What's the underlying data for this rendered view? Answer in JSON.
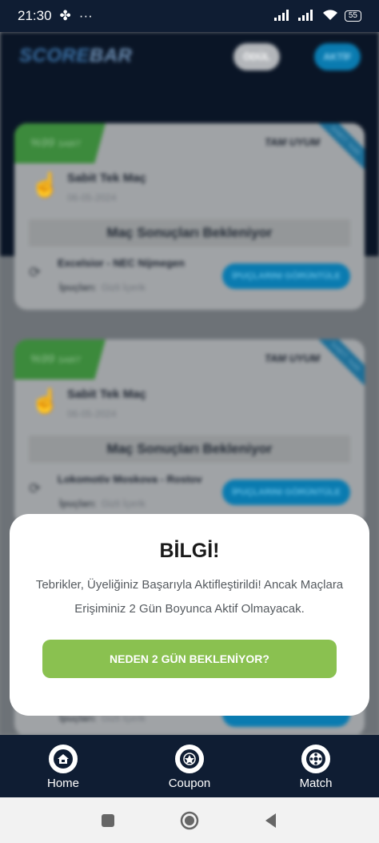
{
  "status_bar": {
    "time": "21:30",
    "dots": "···",
    "battery": "55"
  },
  "app": {
    "logo_main": "SCORE",
    "logo_accent": "BAR",
    "pill_odul": "ÖDÜL",
    "pill_aktif": "AKTİF",
    "cards": [
      {
        "ribbon_value": "%99",
        "ribbon_suffix": "SABİT",
        "tam_uyum": "TAM UYUM",
        "corner": "SABİT: %99",
        "title": "Sabit Tek Maç",
        "date": "06-05-2024",
        "waiting": "Maç Sonuçları Bekleniyor",
        "match": "Excelsior - NEC Nijmegen",
        "hint_label": "İpuçları:",
        "hint_value": "Gizli İçerik",
        "hint_button": "İPUÇLARINI GÖRÜNTÜLE"
      },
      {
        "ribbon_value": "%99",
        "ribbon_suffix": "SABİT",
        "tam_uyum": "TAM UYUM",
        "corner": "SABİT: %99",
        "title": "Sabit Tek Maç",
        "date": "06-05-2024",
        "waiting": "Maç Sonuçları Bekleniyor",
        "match": "Lokomotiv Moskova - Rostov",
        "hint_label": "İpuçları:",
        "hint_value": "Gizli İçerik",
        "hint_button": "İPUÇLARINI GÖRÜNTÜLE"
      },
      {
        "hint_label": "İpuçları:",
        "hint_value": "Gizli İçerik"
      }
    ]
  },
  "modal": {
    "title": "BİLGİ!",
    "message": "Tebrikler, Üyeliğiniz Başarıyla Aktifleştirildi! Ancak Maçlara Erişiminiz 2 Gün Boyunca Aktif Olmayacak.",
    "button": "NEDEN 2 GÜN BEKLENİYOR?"
  },
  "bottom_nav": {
    "items": [
      {
        "label": "Home",
        "icon": "home-icon"
      },
      {
        "label": "Coupon",
        "icon": "coupon-icon"
      },
      {
        "label": "Match",
        "icon": "match-ball-icon"
      }
    ]
  },
  "colors": {
    "navy": "#0f1d33",
    "accent_green": "#8ac150",
    "accent_blue": "#0a7bb0"
  }
}
